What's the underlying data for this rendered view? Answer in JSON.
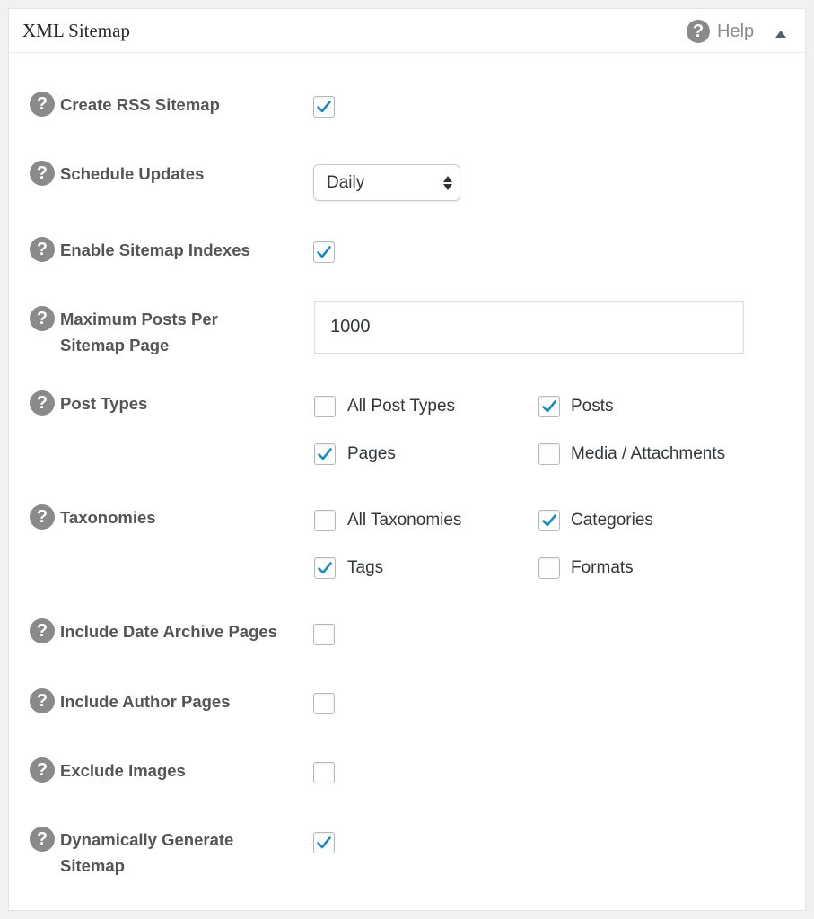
{
  "panel": {
    "title": "XML Sitemap",
    "help_icon": "?",
    "help_label": "Help",
    "collapse_icon": "triangle-up-icon"
  },
  "help_glyph": "?",
  "settings": {
    "rss_sitemap": {
      "label": "Create RSS Sitemap",
      "checked": true
    },
    "schedule_updates": {
      "label": "Schedule Updates",
      "selected": "Daily"
    },
    "sitemap_indexes": {
      "label": "Enable Sitemap Indexes",
      "checked": true
    },
    "max_posts": {
      "label_line1": "Maximum Posts Per",
      "label_line2": "Sitemap Page",
      "value": "1000"
    },
    "post_types": {
      "label": "Post Types",
      "options": [
        {
          "label": "All Post Types",
          "checked": false
        },
        {
          "label": "Posts",
          "checked": true
        },
        {
          "label": "Pages",
          "checked": true
        },
        {
          "label": "Media / Attachments",
          "checked": false
        }
      ]
    },
    "taxonomies": {
      "label": "Taxonomies",
      "options": [
        {
          "label": "All Taxonomies",
          "checked": false
        },
        {
          "label": "Categories",
          "checked": true
        },
        {
          "label": "Tags",
          "checked": true
        },
        {
          "label": "Formats",
          "checked": false
        }
      ]
    },
    "date_archive": {
      "label": "Include Date Archive Pages",
      "checked": false
    },
    "author_pages": {
      "label": "Include Author Pages",
      "checked": false
    },
    "exclude_images": {
      "label": "Exclude Images",
      "checked": false
    },
    "dynamic_generate": {
      "label_line1": "Dynamically Generate",
      "label_line2": "Sitemap",
      "checked": true
    }
  },
  "colors": {
    "check": "#1e8cbe",
    "help_icon_bg": "#8a8a8a"
  }
}
